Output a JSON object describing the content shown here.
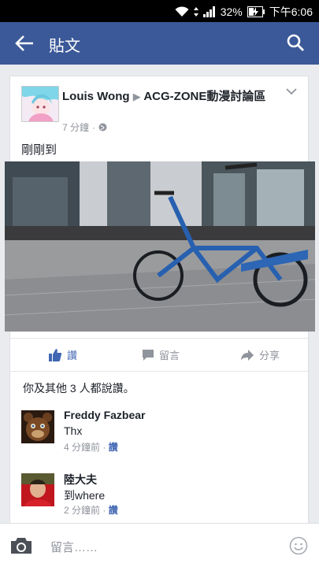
{
  "status": {
    "battery": "32%",
    "time": "下午6:06"
  },
  "appbar": {
    "title": "貼文"
  },
  "post": {
    "poster": "Louis Wong",
    "arrow": "▶",
    "group": "ACG-ZONE動漫討論區",
    "time": "7 分鐘",
    "dot": "·",
    "text": "剛剛到"
  },
  "actions": {
    "like": "讚",
    "comment": "留言",
    "share": "分享"
  },
  "likes": {
    "summary": "你及其他 3 人都說讚。"
  },
  "comments": [
    {
      "name": "Freddy Fazbear",
      "text": "Thx",
      "time": "4 分鐘前",
      "dot": "·",
      "like": "讚"
    },
    {
      "name": "陸大夫",
      "text": "到where",
      "time": "2 分鐘前",
      "dot": "·",
      "like": "讚"
    }
  ],
  "composer": {
    "placeholder": "留言……"
  }
}
